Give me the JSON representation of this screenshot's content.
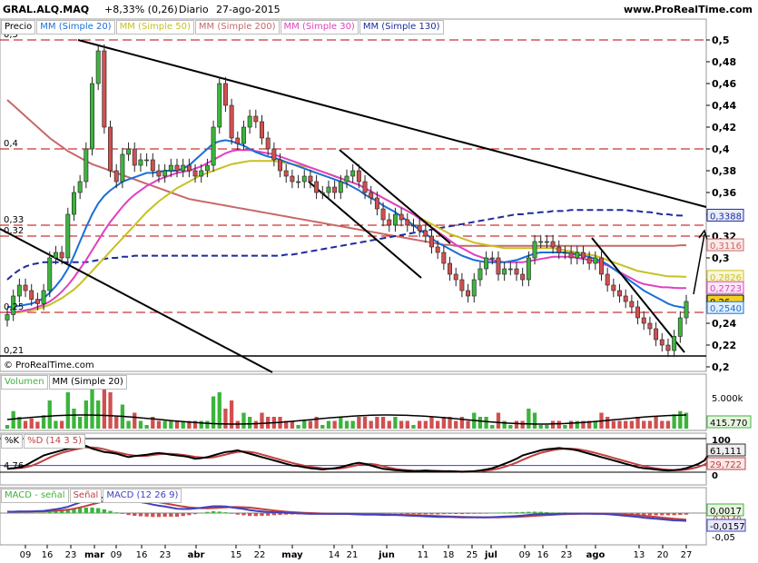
{
  "header": {
    "symbol": "GRAL.ALQ.MAQ",
    "change": "+8,33% (0,26)",
    "period": "Diario",
    "date": "27-ago-2015",
    "brand": "www.ProRealTime.com"
  },
  "colors": {
    "sma20": "#1a6fd6",
    "sma50": "#c8c020",
    "sma200": "#c86868",
    "sma30": "#e040c0",
    "sma130": "#1c2c9c",
    "bull": "#3cb43c",
    "bear": "#d05050",
    "hline": "#c00000",
    "macd_line": "#4040c0",
    "signal_line": "#c04040"
  },
  "price_panel": {
    "legend": [
      "Precio",
      "MM (Simple 20)",
      "MM (Simple 50)",
      "MM (Simple 200)",
      "MM (Simple 30)",
      "MM (Simple 130)"
    ],
    "watermark": "© ProRealTime.com",
    "left_levels": [
      "0,5",
      "0,4",
      "0,33",
      "0,32",
      "0,25",
      "0,21"
    ],
    "right_badges": [
      "0,3388",
      "0,3116",
      "0,2826",
      "0,2723",
      "0,26",
      "0,2540"
    ]
  },
  "volume_panel": {
    "legend": [
      "Volumen",
      "MM (Simple 20)"
    ],
    "axis_label": "5.000k",
    "badge": "415.770"
  },
  "stoch_panel": {
    "legend": [
      "%K",
      "%D (14 3 5)"
    ],
    "axis_labels": [
      "100",
      "0"
    ],
    "left_level": "4,76",
    "badges": [
      "61,111",
      "29,722"
    ]
  },
  "macd_panel": {
    "legend": [
      "MACD - señal",
      "Señal",
      "MACD (12 26 9)"
    ],
    "axis_label": "-0,05",
    "badges": [
      "0,0017",
      "-0,0140",
      "-0,0157"
    ]
  },
  "x_axis": {
    "labels": [
      "09",
      "16",
      "23",
      "mar",
      "09",
      "16",
      "23",
      "abr",
      "15",
      "22",
      "may",
      "14",
      "21",
      "jun",
      "11",
      "18",
      "25",
      "jul",
      "09",
      "16",
      "23",
      "ago",
      "13",
      "20",
      "27"
    ]
  },
  "chart_data": {
    "type": "candlestick",
    "y_ticks": [
      "0,5",
      "0,48",
      "0,46",
      "0,44",
      "0,42",
      "0,4",
      "0,38",
      "0,36",
      "0,34",
      "0,32",
      "0,3",
      "0,28",
      "0,26",
      "0,24",
      "0,22",
      "0,2"
    ],
    "ylim": [
      0.2,
      0.5
    ],
    "horizontal_levels": [
      0.5,
      0.4,
      0.33,
      0.32,
      0.25,
      0.21
    ],
    "close": [
      0.248,
      0.265,
      0.275,
      0.27,
      0.262,
      0.258,
      0.27,
      0.3,
      0.305,
      0.3,
      0.34,
      0.36,
      0.37,
      0.4,
      0.46,
      0.49,
      0.42,
      0.38,
      0.37,
      0.395,
      0.4,
      0.385,
      0.39,
      0.39,
      0.38,
      0.375,
      0.38,
      0.385,
      0.38,
      0.385,
      0.38,
      0.375,
      0.38,
      0.385,
      0.42,
      0.46,
      0.44,
      0.41,
      0.405,
      0.42,
      0.43,
      0.425,
      0.41,
      0.4,
      0.39,
      0.38,
      0.375,
      0.37,
      0.37,
      0.375,
      0.37,
      0.36,
      0.36,
      0.365,
      0.36,
      0.37,
      0.375,
      0.38,
      0.37,
      0.36,
      0.355,
      0.345,
      0.335,
      0.33,
      0.34,
      0.335,
      0.33,
      0.33,
      0.325,
      0.32,
      0.31,
      0.305,
      0.295,
      0.285,
      0.28,
      0.27,
      0.265,
      0.28,
      0.29,
      0.3,
      0.3,
      0.285,
      0.29,
      0.29,
      0.285,
      0.28,
      0.3,
      0.315,
      0.315,
      0.315,
      0.31,
      0.305,
      0.305,
      0.3,
      0.305,
      0.3,
      0.295,
      0.3,
      0.285,
      0.275,
      0.27,
      0.265,
      0.26,
      0.255,
      0.245,
      0.24,
      0.235,
      0.225,
      0.22,
      0.215,
      0.228,
      0.245,
      0.26
    ],
    "sma20": [
      0.255,
      0.255,
      0.256,
      0.257,
      0.258,
      0.26,
      0.263,
      0.268,
      0.274,
      0.281,
      0.29,
      0.302,
      0.315,
      0.328,
      0.34,
      0.35,
      0.357,
      0.362,
      0.366,
      0.37,
      0.372,
      0.374,
      0.376,
      0.378,
      0.378,
      0.379,
      0.38,
      0.38,
      0.38,
      0.382,
      0.385,
      0.39,
      0.395,
      0.4,
      0.405,
      0.407,
      0.408,
      0.407,
      0.405,
      0.403,
      0.4,
      0.397,
      0.395,
      0.393,
      0.392,
      0.39,
      0.388,
      0.386,
      0.384,
      0.382,
      0.38,
      0.378,
      0.376,
      0.374,
      0.372,
      0.37,
      0.368,
      0.365,
      0.362,
      0.358,
      0.355,
      0.352,
      0.348,
      0.345,
      0.342,
      0.338,
      0.334,
      0.33,
      0.326,
      0.322,
      0.318,
      0.314,
      0.311,
      0.308,
      0.305,
      0.302,
      0.3,
      0.298,
      0.297,
      0.296,
      0.296,
      0.296,
      0.296,
      0.297,
      0.298,
      0.3,
      0.302,
      0.304,
      0.305,
      0.305,
      0.305,
      0.305,
      0.305,
      0.304,
      0.303,
      0.302,
      0.301,
      0.299,
      0.297,
      0.294,
      0.29,
      0.286,
      0.282,
      0.278,
      0.274,
      0.27,
      0.267,
      0.264,
      0.261,
      0.258,
      0.256,
      0.255,
      0.254
    ],
    "sma50": [
      0.25,
      0.25,
      0.25,
      0.251,
      0.252,
      0.253,
      0.255,
      0.257,
      0.26,
      0.263,
      0.267,
      0.271,
      0.276,
      0.282,
      0.288,
      0.294,
      0.3,
      0.306,
      0.312,
      0.318,
      0.324,
      0.33,
      0.336,
      0.342,
      0.347,
      0.352,
      0.356,
      0.36,
      0.364,
      0.367,
      0.37,
      0.373,
      0.376,
      0.378,
      0.38,
      0.382,
      0.384,
      0.386,
      0.387,
      0.388,
      0.389,
      0.389,
      0.389,
      0.389,
      0.389,
      0.388,
      0.387,
      0.386,
      0.385,
      0.384,
      0.383,
      0.381,
      0.379,
      0.377,
      0.375,
      0.373,
      0.371,
      0.369,
      0.367,
      0.364,
      0.361,
      0.358,
      0.355,
      0.352,
      0.349,
      0.346,
      0.343,
      0.34,
      0.337,
      0.334,
      0.331,
      0.328,
      0.325,
      0.322,
      0.32,
      0.318,
      0.316,
      0.314,
      0.313,
      0.312,
      0.311,
      0.31,
      0.309,
      0.309,
      0.309,
      0.309,
      0.309,
      0.309,
      0.309,
      0.309,
      0.309,
      0.308,
      0.307,
      0.306,
      0.305,
      0.304,
      0.303,
      0.302,
      0.3,
      0.298,
      0.296,
      0.294,
      0.292,
      0.29,
      0.288,
      0.287,
      0.286,
      0.285,
      0.284,
      0.283,
      0.283,
      0.2828,
      0.2826
    ],
    "sma200": [
      0.445,
      0.44,
      0.435,
      0.43,
      0.425,
      0.42,
      0.415,
      0.41,
      0.406,
      0.402,
      0.398,
      0.395,
      0.392,
      0.389,
      0.386,
      0.384,
      0.382,
      0.38,
      0.378,
      0.376,
      0.374,
      0.372,
      0.37,
      0.368,
      0.366,
      0.364,
      0.362,
      0.36,
      0.358,
      0.356,
      0.354,
      0.353,
      0.352,
      0.351,
      0.35,
      0.349,
      0.348,
      0.347,
      0.346,
      0.345,
      0.344,
      0.343,
      0.342,
      0.341,
      0.34,
      0.339,
      0.338,
      0.337,
      0.336,
      0.335,
      0.334,
      0.333,
      0.332,
      0.331,
      0.33,
      0.329,
      0.328,
      0.327,
      0.326,
      0.325,
      0.324,
      0.323,
      0.322,
      0.321,
      0.32,
      0.319,
      0.318,
      0.317,
      0.316,
      0.315,
      0.314,
      0.313,
      0.312,
      0.312,
      0.311,
      0.311,
      0.311,
      0.311,
      0.311,
      0.311,
      0.311,
      0.311,
      0.311,
      0.311,
      0.311,
      0.311,
      0.311,
      0.311,
      0.311,
      0.311,
      0.311,
      0.311,
      0.311,
      0.311,
      0.311,
      0.311,
      0.311,
      0.311,
      0.311,
      0.311,
      0.311,
      0.311,
      0.311,
      0.311,
      0.311,
      0.311,
      0.311,
      0.311,
      0.311,
      0.311,
      0.311,
      0.3116,
      0.3116
    ],
    "sma30": [
      0.25,
      0.25,
      0.251,
      0.252,
      0.253,
      0.255,
      0.257,
      0.26,
      0.264,
      0.269,
      0.275,
      0.282,
      0.29,
      0.298,
      0.307,
      0.316,
      0.325,
      0.333,
      0.34,
      0.347,
      0.353,
      0.358,
      0.362,
      0.366,
      0.369,
      0.372,
      0.374,
      0.376,
      0.378,
      0.379,
      0.38,
      0.382,
      0.384,
      0.387,
      0.39,
      0.393,
      0.396,
      0.398,
      0.399,
      0.399,
      0.399,
      0.398,
      0.397,
      0.396,
      0.395,
      0.393,
      0.391,
      0.389,
      0.387,
      0.385,
      0.383,
      0.381,
      0.379,
      0.377,
      0.375,
      0.373,
      0.371,
      0.369,
      0.367,
      0.364,
      0.361,
      0.358,
      0.355,
      0.352,
      0.349,
      0.346,
      0.343,
      0.34,
      0.336,
      0.332,
      0.328,
      0.324,
      0.32,
      0.316,
      0.312,
      0.309,
      0.306,
      0.303,
      0.301,
      0.299,
      0.298,
      0.297,
      0.296,
      0.296,
      0.296,
      0.296,
      0.297,
      0.298,
      0.299,
      0.3,
      0.301,
      0.301,
      0.301,
      0.301,
      0.3,
      0.299,
      0.298,
      0.297,
      0.295,
      0.293,
      0.29,
      0.287,
      0.284,
      0.281,
      0.278,
      0.276,
      0.275,
      0.274,
      0.273,
      0.273,
      0.2725,
      0.2723,
      0.2723
    ],
    "sma130": [
      0.28,
      0.285,
      0.289,
      0.292,
      0.294,
      0.295,
      0.296,
      0.296,
      0.296,
      0.296,
      0.296,
      0.296,
      0.296,
      0.296,
      0.297,
      0.298,
      0.299,
      0.3,
      0.3,
      0.301,
      0.301,
      0.302,
      0.302,
      0.302,
      0.302,
      0.302,
      0.302,
      0.302,
      0.302,
      0.302,
      0.302,
      0.302,
      0.302,
      0.302,
      0.302,
      0.302,
      0.302,
      0.302,
      0.302,
      0.302,
      0.302,
      0.302,
      0.302,
      0.302,
      0.302,
      0.302,
      0.303,
      0.303,
      0.304,
      0.305,
      0.306,
      0.307,
      0.308,
      0.309,
      0.31,
      0.311,
      0.312,
      0.313,
      0.314,
      0.315,
      0.316,
      0.317,
      0.318,
      0.319,
      0.32,
      0.321,
      0.322,
      0.323,
      0.324,
      0.325,
      0.326,
      0.327,
      0.328,
      0.329,
      0.33,
      0.331,
      0.332,
      0.333,
      0.334,
      0.335,
      0.336,
      0.337,
      0.338,
      0.339,
      0.34,
      0.34,
      0.341,
      0.341,
      0.342,
      0.342,
      0.343,
      0.343,
      0.343,
      0.344,
      0.344,
      0.344,
      0.344,
      0.344,
      0.344,
      0.344,
      0.344,
      0.344,
      0.344,
      0.343,
      0.343,
      0.342,
      0.342,
      0.341,
      0.34,
      0.34,
      0.339,
      0.3388,
      0.3388
    ],
    "stoch_k": [
      10,
      12,
      15,
      20,
      30,
      40,
      50,
      55,
      60,
      65,
      70,
      72,
      75,
      78,
      70,
      65,
      60,
      58,
      55,
      50,
      45,
      48,
      50,
      52,
      55,
      57,
      55,
      52,
      50,
      48,
      45,
      40,
      42,
      45,
      50,
      55,
      60,
      62,
      65,
      60,
      55,
      50,
      45,
      40,
      35,
      30,
      25,
      20,
      18,
      15,
      12,
      10,
      8,
      10,
      12,
      15,
      20,
      25,
      28,
      25,
      20,
      15,
      10,
      8,
      6,
      5,
      4,
      3,
      4,
      5,
      4,
      3,
      2,
      3,
      2,
      1,
      2,
      3,
      5,
      8,
      12,
      18,
      25,
      32,
      40,
      50,
      55,
      60,
      65,
      68,
      70,
      72,
      70,
      68,
      65,
      60,
      55,
      50,
      45,
      40,
      35,
      30,
      25,
      20,
      15,
      12,
      10,
      8,
      6,
      5,
      6,
      8,
      12,
      18,
      25,
      35,
      61
    ]
  }
}
